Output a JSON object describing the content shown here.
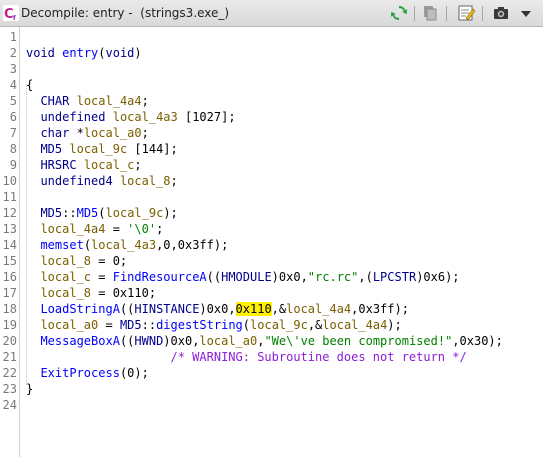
{
  "window": {
    "title_prefix": "Decompile: entry -",
    "title_file": "(strings3.exe_)",
    "logo_text": "C"
  },
  "toolbar": {
    "buttons": [
      "refresh-icon",
      "copy-icon",
      "edit-function-signature-icon",
      "snapshot-icon",
      "more-actions-icon"
    ]
  },
  "colors": {
    "keyword": "#00008b",
    "function": "#0000ff",
    "variable": "#7a6000",
    "string": "#008000",
    "comment": "#8b1ed8",
    "highlight": "#fff200"
  },
  "code": {
    "line_numbers": [
      "1",
      "2",
      "3",
      "4",
      "5",
      "6",
      "7",
      "8",
      "9",
      "10",
      "11",
      "12",
      "13",
      "14",
      "15",
      "16",
      "17",
      "18",
      "19",
      "20",
      "21",
      "22",
      "23",
      "24"
    ],
    "lines": [
      [],
      [
        {
          "t": "void",
          "c": "kw"
        },
        {
          "t": " ",
          "c": "pl"
        },
        {
          "t": "entry",
          "c": "fn"
        },
        {
          "t": "(",
          "c": "pl"
        },
        {
          "t": "void",
          "c": "kw"
        },
        {
          "t": ")",
          "c": "pl"
        }
      ],
      [],
      [
        {
          "t": "{",
          "c": "pl"
        }
      ],
      [
        {
          "t": "  ",
          "c": "pl"
        },
        {
          "t": "CHAR",
          "c": "kw"
        },
        {
          "t": " ",
          "c": "pl"
        },
        {
          "t": "local_4a4",
          "c": "var"
        },
        {
          "t": ";",
          "c": "pl"
        }
      ],
      [
        {
          "t": "  ",
          "c": "pl"
        },
        {
          "t": "undefined",
          "c": "kw"
        },
        {
          "t": " ",
          "c": "pl"
        },
        {
          "t": "local_4a3",
          "c": "var"
        },
        {
          "t": " [1027];",
          "c": "pl"
        }
      ],
      [
        {
          "t": "  ",
          "c": "pl"
        },
        {
          "t": "char",
          "c": "kw"
        },
        {
          "t": " *",
          "c": "pl"
        },
        {
          "t": "local_a0",
          "c": "var"
        },
        {
          "t": ";",
          "c": "pl"
        }
      ],
      [
        {
          "t": "  ",
          "c": "pl"
        },
        {
          "t": "MD5",
          "c": "kw"
        },
        {
          "t": " ",
          "c": "pl"
        },
        {
          "t": "local_9c",
          "c": "var"
        },
        {
          "t": " [144];",
          "c": "pl"
        }
      ],
      [
        {
          "t": "  ",
          "c": "pl"
        },
        {
          "t": "HRSRC",
          "c": "kw"
        },
        {
          "t": " ",
          "c": "pl"
        },
        {
          "t": "local_c",
          "c": "var"
        },
        {
          "t": ";",
          "c": "pl"
        }
      ],
      [
        {
          "t": "  ",
          "c": "pl"
        },
        {
          "t": "undefined4",
          "c": "kw"
        },
        {
          "t": " ",
          "c": "pl"
        },
        {
          "t": "local_8",
          "c": "var"
        },
        {
          "t": ";",
          "c": "pl"
        }
      ],
      [],
      [
        {
          "t": "  ",
          "c": "pl"
        },
        {
          "t": "MD5",
          "c": "kw"
        },
        {
          "t": "::",
          "c": "pl"
        },
        {
          "t": "MD5",
          "c": "fn"
        },
        {
          "t": "(",
          "c": "pl"
        },
        {
          "t": "local_9c",
          "c": "var"
        },
        {
          "t": ");",
          "c": "pl"
        }
      ],
      [
        {
          "t": "  ",
          "c": "pl"
        },
        {
          "t": "local_4a4",
          "c": "var"
        },
        {
          "t": " = ",
          "c": "pl"
        },
        {
          "t": "'\\0'",
          "c": "str"
        },
        {
          "t": ";",
          "c": "pl"
        }
      ],
      [
        {
          "t": "  ",
          "c": "pl"
        },
        {
          "t": "memset",
          "c": "fn"
        },
        {
          "t": "(",
          "c": "pl"
        },
        {
          "t": "local_4a3",
          "c": "var"
        },
        {
          "t": ",0,0x3ff);",
          "c": "pl"
        }
      ],
      [
        {
          "t": "  ",
          "c": "pl"
        },
        {
          "t": "local_8",
          "c": "var"
        },
        {
          "t": " = 0;",
          "c": "pl"
        }
      ],
      [
        {
          "t": "  ",
          "c": "pl"
        },
        {
          "t": "local_c",
          "c": "var"
        },
        {
          "t": " = ",
          "c": "pl"
        },
        {
          "t": "FindResourceA",
          "c": "fn"
        },
        {
          "t": "((",
          "c": "pl"
        },
        {
          "t": "HMODULE",
          "c": "kw"
        },
        {
          "t": ")0x0,",
          "c": "pl"
        },
        {
          "t": "\"rc.rc\"",
          "c": "str"
        },
        {
          "t": ",(",
          "c": "pl"
        },
        {
          "t": "LPCSTR",
          "c": "kw"
        },
        {
          "t": ")0x6);",
          "c": "pl"
        }
      ],
      [
        {
          "t": "  ",
          "c": "pl"
        },
        {
          "t": "local_8",
          "c": "var"
        },
        {
          "t": " = 0x110;",
          "c": "pl"
        }
      ],
      [
        {
          "t": "  ",
          "c": "pl"
        },
        {
          "t": "LoadStringA",
          "c": "fn"
        },
        {
          "t": "((",
          "c": "pl"
        },
        {
          "t": "HINSTANCE",
          "c": "kw"
        },
        {
          "t": ")0x0,",
          "c": "pl"
        },
        {
          "t": "0x110",
          "c": "hl"
        },
        {
          "t": ",&",
          "c": "pl"
        },
        {
          "t": "local_4a4",
          "c": "var"
        },
        {
          "t": ",0x3ff);",
          "c": "pl"
        }
      ],
      [
        {
          "t": "  ",
          "c": "pl"
        },
        {
          "t": "local_a0",
          "c": "var"
        },
        {
          "t": " = ",
          "c": "pl"
        },
        {
          "t": "MD5",
          "c": "kw"
        },
        {
          "t": "::",
          "c": "pl"
        },
        {
          "t": "digestString",
          "c": "fn"
        },
        {
          "t": "(",
          "c": "pl"
        },
        {
          "t": "local_9c",
          "c": "var"
        },
        {
          "t": ",&",
          "c": "pl"
        },
        {
          "t": "local_4a4",
          "c": "var"
        },
        {
          "t": ");",
          "c": "pl"
        }
      ],
      [
        {
          "t": "  ",
          "c": "pl"
        },
        {
          "t": "MessageBoxA",
          "c": "fn"
        },
        {
          "t": "((",
          "c": "pl"
        },
        {
          "t": "HWND",
          "c": "kw"
        },
        {
          "t": ")0x0,",
          "c": "pl"
        },
        {
          "t": "local_a0",
          "c": "var"
        },
        {
          "t": ",",
          "c": "pl"
        },
        {
          "t": "\"We\\'ve been compromised!\"",
          "c": "str"
        },
        {
          "t": ",0x30);",
          "c": "pl"
        }
      ],
      [
        {
          "t": "                    ",
          "c": "pl"
        },
        {
          "t": "/* WARNING: Subroutine does not return */",
          "c": "cmt"
        }
      ],
      [
        {
          "t": "  ",
          "c": "pl"
        },
        {
          "t": "ExitProcess",
          "c": "fn"
        },
        {
          "t": "(0);",
          "c": "pl"
        }
      ],
      [
        {
          "t": "}",
          "c": "pl"
        }
      ],
      []
    ]
  }
}
